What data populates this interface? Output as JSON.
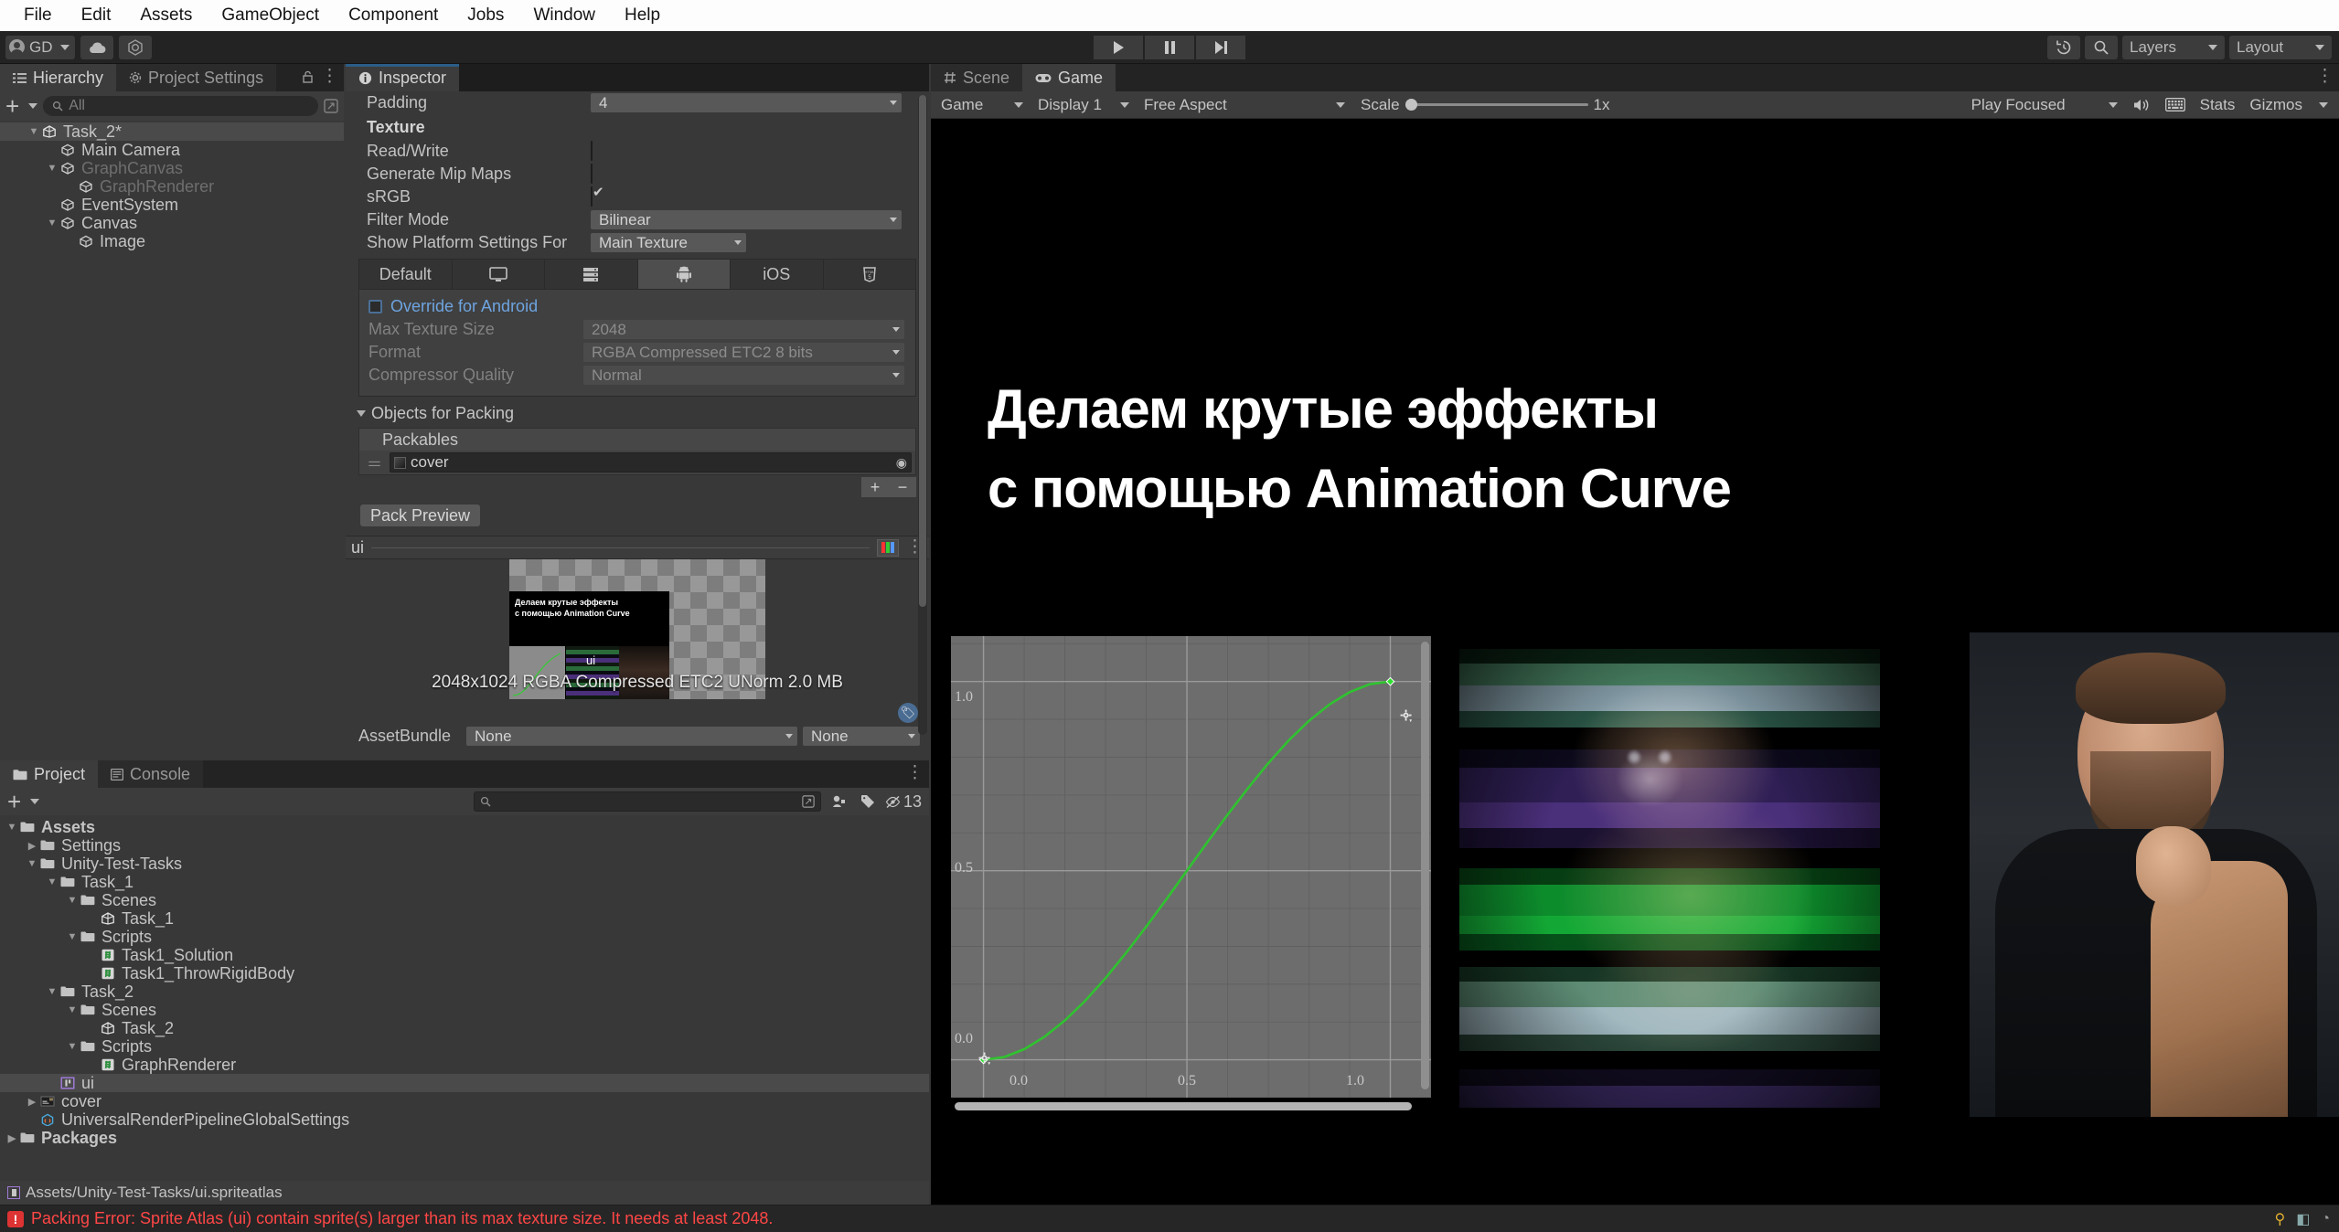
{
  "menubar": {
    "items": [
      "File",
      "Edit",
      "Assets",
      "GameObject",
      "Component",
      "Jobs",
      "Window",
      "Help"
    ]
  },
  "toolbar": {
    "account_label": "GD",
    "cloud_icon": "cloud-icon",
    "collab_icon": "unity-collab-icon",
    "play_icon": "play-icon",
    "pause_icon": "pause-icon",
    "step_icon": "step-icon",
    "history_icon": "undo-history-icon",
    "search_icon": "search-icon",
    "layers_label": "Layers",
    "layout_label": "Layout"
  },
  "hierarchy": {
    "tab_label": "Hierarchy",
    "tab_icon": "hierarchy-icon",
    "settings_tab_label": "Project Settings",
    "settings_tab_icon": "gear-icon",
    "lock_icon": "lock-icon",
    "kebab_icon": "kebab-icon",
    "add_label": "+",
    "search_placeholder": "All",
    "items": [
      {
        "label": "Task_2*",
        "depth": 1,
        "icon": "unity-scene-icon",
        "arrow": "down",
        "selected": true,
        "dim": false
      },
      {
        "label": "Main Camera",
        "depth": 2,
        "icon": "gameobject-icon",
        "arrow": "none",
        "selected": false,
        "dim": false
      },
      {
        "label": "GraphCanvas",
        "depth": 2,
        "icon": "gameobject-icon",
        "arrow": "down",
        "selected": false,
        "dim": true
      },
      {
        "label": "GraphRenderer",
        "depth": 3,
        "icon": "gameobject-icon",
        "arrow": "none",
        "selected": false,
        "dim": true
      },
      {
        "label": "EventSystem",
        "depth": 2,
        "icon": "gameobject-icon",
        "arrow": "none",
        "selected": false,
        "dim": false
      },
      {
        "label": "Canvas",
        "depth": 2,
        "icon": "gameobject-icon",
        "arrow": "down",
        "selected": false,
        "dim": false
      },
      {
        "label": "Image",
        "depth": 3,
        "icon": "gameobject-icon",
        "arrow": "none",
        "selected": false,
        "dim": false
      }
    ]
  },
  "inspector": {
    "tab_label": "Inspector",
    "tab_icon": "info-icon",
    "padding_label": "Padding",
    "padding_value": "4",
    "texture_header": "Texture",
    "readwrite_label": "Read/Write",
    "readwrite_checked": false,
    "mipmaps_label": "Generate Mip Maps",
    "mipmaps_checked": false,
    "srgb_label": "sRGB",
    "srgb_checked": true,
    "filter_mode_label": "Filter Mode",
    "filter_mode_value": "Bilinear",
    "platform_settings_label": "Show Platform Settings For",
    "platform_settings_value": "Main Texture",
    "platform_tabs": [
      {
        "label": "Default",
        "icon": "",
        "selected": false
      },
      {
        "label": "",
        "icon": "standalone-monitor-icon",
        "selected": false
      },
      {
        "label": "",
        "icon": "server-icon",
        "selected": false
      },
      {
        "label": "",
        "icon": "android-icon",
        "selected": true
      },
      {
        "label": "iOS",
        "icon": "",
        "selected": false
      },
      {
        "label": "",
        "icon": "webgl-html5-icon",
        "selected": false
      }
    ],
    "override_label": "Override for Android",
    "override_checked": false,
    "max_texture_size_label": "Max Texture Size",
    "max_texture_size_value": "2048",
    "format_label": "Format",
    "format_value": "RGBA Compressed ETC2 8 bits",
    "compressor_quality_label": "Compressor Quality",
    "compressor_quality_value": "Normal",
    "objects_for_packing_label": "Objects for Packing",
    "packables_label": "Packables",
    "packable_items": [
      {
        "name": "cover",
        "icon": "texture-asset-icon"
      }
    ],
    "add_btn": "+",
    "remove_btn": "−",
    "pack_preview_label": "Pack Preview",
    "preview_title": "ui",
    "preview_rgb_icon": "rgb-channels-icon",
    "preview_kebab_icon": "kebab-icon",
    "preview_info": "2048x1024 RGBA Compressed ETC2 UNorm   2.0 MB",
    "preview_sprite_label": "ui",
    "preview_thumb_line1": "Делаем крутые эффекты",
    "preview_thumb_line2": "с помощью Animation Curve",
    "assetbundle_label": "AssetBundle",
    "assetbundle_value": "None",
    "assetbundle_variant": "None",
    "tag_icon": "label-tag-icon"
  },
  "gameview": {
    "scene_tab_label": "Scene",
    "scene_tab_icon": "scene-grid-icon",
    "game_tab_label": "Game",
    "game_tab_icon": "gamepad-icon",
    "kebab_icon": "kebab-icon",
    "mode_value": "Game",
    "display_value": "Display 1",
    "aspect_value": "Free Aspect",
    "scale_label": "Scale",
    "scale_value": "1x",
    "play_focused_value": "Play Focused",
    "mute_icon": "speaker-icon",
    "keyboard_icon": "keyboard-icon",
    "stats_label": "Stats",
    "gizmos_label": "Gizmos",
    "title_line1": "Делаем крутые эффекты",
    "title_line2": "с помощью Animation Curve"
  },
  "chart_data": {
    "type": "line",
    "title": "Animation Curve",
    "xlabel": "",
    "ylabel": "",
    "xlim": [
      -0.08,
      1.1
    ],
    "ylim": [
      -0.1,
      1.12
    ],
    "xticks": [
      "0.0",
      "0.5",
      "1.0"
    ],
    "yticks": [
      "0.0",
      "0.5",
      "1.0"
    ],
    "xtick_values": [
      0.0,
      0.5,
      1.0
    ],
    "ytick_values": [
      0.0,
      0.5,
      1.0
    ],
    "grid": true,
    "line_color": "#2fc32f",
    "keyframes": [
      {
        "time": 0.0,
        "value": 0.0
      },
      {
        "time": 1.0,
        "value": 1.0
      }
    ],
    "x": [
      0.0,
      0.05,
      0.1,
      0.15,
      0.2,
      0.25,
      0.3,
      0.35,
      0.4,
      0.45,
      0.5,
      0.55,
      0.6,
      0.65,
      0.7,
      0.75,
      0.8,
      0.85,
      0.9,
      0.95,
      1.0
    ],
    "values": [
      0.0,
      0.007,
      0.028,
      0.061,
      0.104,
      0.156,
      0.216,
      0.282,
      0.352,
      0.425,
      0.5,
      0.575,
      0.648,
      0.718,
      0.784,
      0.844,
      0.896,
      0.939,
      0.972,
      0.993,
      1.0
    ]
  },
  "project": {
    "tab_label": "Project",
    "tab_icon": "folder-icon",
    "console_tab_label": "Console",
    "console_tab_icon": "console-icon",
    "kebab_icon": "kebab-icon",
    "add_label": "+",
    "search_placeholder": "",
    "search_icon": "search-icon",
    "favorite_icon": "save-search-icon",
    "label_icon": "label-tag-icon",
    "hidden_count": "13",
    "hidden_icon": "hidden-packages-icon",
    "tree": [
      {
        "label": "Assets",
        "depth": 0,
        "icon": "folder-open-icon",
        "arrow": "down",
        "bold": true,
        "selected": false
      },
      {
        "label": "Settings",
        "depth": 1,
        "icon": "folder-icon",
        "arrow": "right",
        "bold": false,
        "selected": false
      },
      {
        "label": "Unity-Test-Tasks",
        "depth": 1,
        "icon": "folder-open-icon",
        "arrow": "down",
        "bold": false,
        "selected": false
      },
      {
        "label": "Task_1",
        "depth": 2,
        "icon": "folder-open-icon",
        "arrow": "down",
        "bold": false,
        "selected": false
      },
      {
        "label": "Scenes",
        "depth": 3,
        "icon": "folder-open-icon",
        "arrow": "down",
        "bold": false,
        "selected": false
      },
      {
        "label": "Task_1",
        "depth": 4,
        "icon": "unity-scene-icon",
        "arrow": "none",
        "bold": false,
        "selected": false
      },
      {
        "label": "Scripts",
        "depth": 3,
        "icon": "folder-open-icon",
        "arrow": "down",
        "bold": false,
        "selected": false
      },
      {
        "label": "Task1_Solution",
        "depth": 4,
        "icon": "csharp-script-icon",
        "arrow": "none",
        "bold": false,
        "selected": false
      },
      {
        "label": "Task1_ThrowRigidBody",
        "depth": 4,
        "icon": "csharp-script-icon",
        "arrow": "none",
        "bold": false,
        "selected": false
      },
      {
        "label": "Task_2",
        "depth": 2,
        "icon": "folder-open-icon",
        "arrow": "down",
        "bold": false,
        "selected": false
      },
      {
        "label": "Scenes",
        "depth": 3,
        "icon": "folder-open-icon",
        "arrow": "down",
        "bold": false,
        "selected": false
      },
      {
        "label": "Task_2",
        "depth": 4,
        "icon": "unity-scene-icon",
        "arrow": "none",
        "bold": false,
        "selected": false
      },
      {
        "label": "Scripts",
        "depth": 3,
        "icon": "folder-open-icon",
        "arrow": "down",
        "bold": false,
        "selected": false
      },
      {
        "label": "GraphRenderer",
        "depth": 4,
        "icon": "csharp-script-icon",
        "arrow": "none",
        "bold": false,
        "selected": false
      },
      {
        "label": "ui",
        "depth": 2,
        "icon": "sprite-atlas-icon",
        "arrow": "none",
        "bold": false,
        "selected": true
      },
      {
        "label": "cover",
        "depth": 1,
        "icon": "texture-asset-icon",
        "arrow": "right",
        "bold": false,
        "selected": false
      },
      {
        "label": "UniversalRenderPipelineGlobalSettings",
        "depth": 1,
        "icon": "scriptable-object-icon",
        "arrow": "none",
        "bold": false,
        "selected": false
      },
      {
        "label": "Packages",
        "depth": 0,
        "icon": "folder-icon",
        "arrow": "right",
        "bold": true,
        "selected": false
      }
    ],
    "status_path": "Assets/Unity-Test-Tasks/ui.spriteatlas",
    "status_icon": "sprite-atlas-icon"
  },
  "errorbar": {
    "icon": "error-icon",
    "message": "Packing Error: Sprite Atlas (ui) contain sprite(s) larger than its max texture size. It needs at least 2048."
  }
}
